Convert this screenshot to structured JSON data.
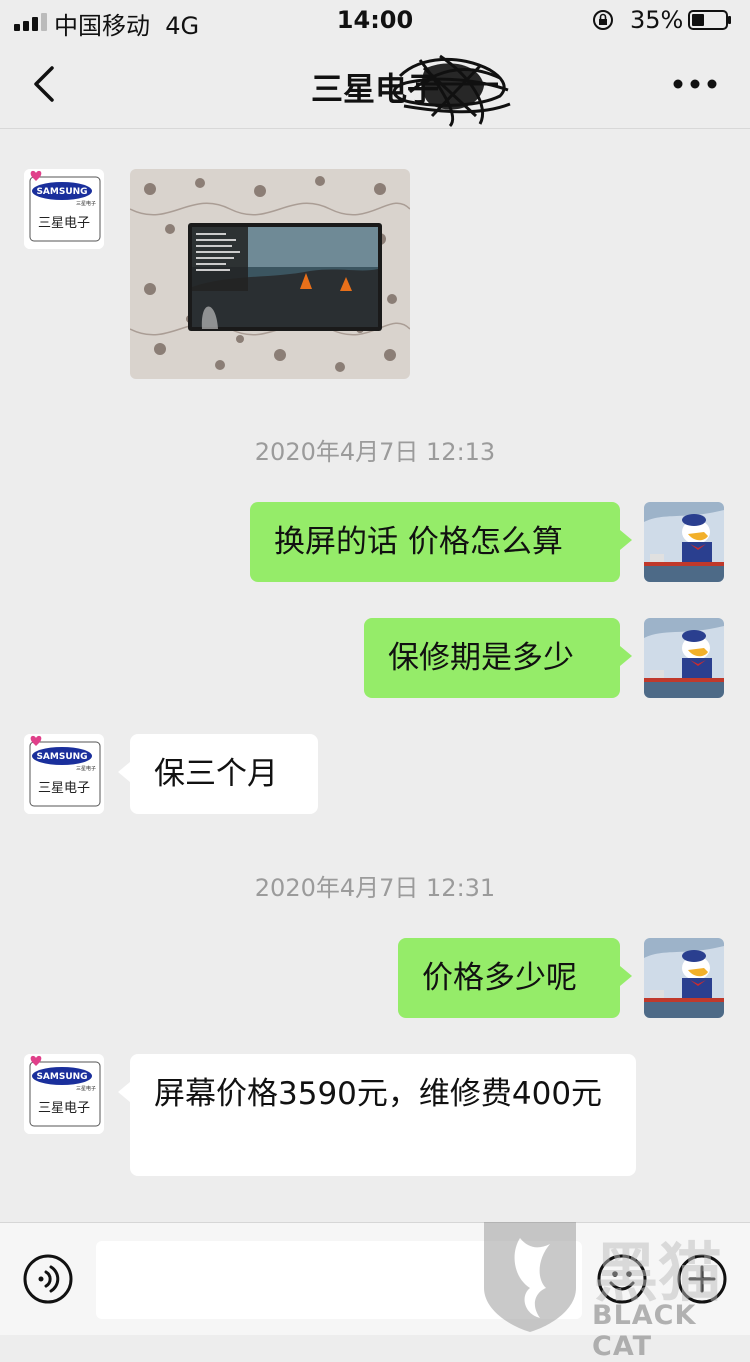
{
  "status": {
    "carrier": "中国移动",
    "network": "4G",
    "time": "14:00",
    "battery": "35%"
  },
  "nav": {
    "title": "三星电子",
    "back_icon": "chevron-left-icon",
    "more_icon": "more-dots-icon"
  },
  "avatar_other": {
    "brand": "SAMSUNG",
    "sub": "三星电子",
    "tiny": "三星电子",
    "caption": "三星电子"
  },
  "timestamps": [
    "2020年4月7日 12:13",
    "2020年4月7日 12:31"
  ],
  "messages": {
    "m1": "换屏的话 价格怎么算",
    "m2": "保修期是多少",
    "m3": "保三个月",
    "m4": "价格多少呢",
    "m5": "屏幕价格3590元，维修费400元"
  },
  "watermark": {
    "text": "BLACK CAT",
    "cn": "黑猫"
  },
  "colors": {
    "my_bubble": "#95ec69",
    "other_bubble": "#ffffff",
    "bg": "#ededed"
  }
}
